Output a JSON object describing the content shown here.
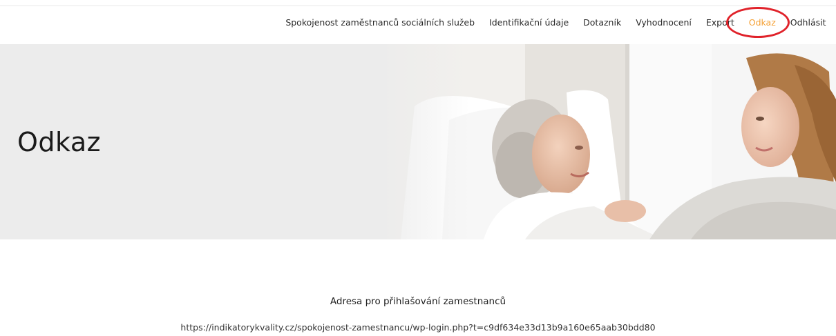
{
  "nav": {
    "items": [
      {
        "label": "Spokojenost zaměstnanců sociálních služeb",
        "active": false
      },
      {
        "label": "Identifikační údaje",
        "active": false
      },
      {
        "label": "Dotazník",
        "active": false
      },
      {
        "label": "Vyhodnocení",
        "active": false
      },
      {
        "label": "Export",
        "active": false
      },
      {
        "label": "Odkaz",
        "active": true
      },
      {
        "label": "Odhlásit",
        "active": false
      }
    ],
    "active_color": "#f5a033",
    "highlight_color": "#e0222a"
  },
  "hero": {
    "title": "Odkaz",
    "background_color": "#ececec"
  },
  "main": {
    "address_label": "Adresa pro přihlašování zamestnanců",
    "address_url": "https://indikatorykvality.cz/spokojenost-zamestnancu/wp-login.php?t=c9df634e33d13b9a160e65aab30bdd80"
  }
}
